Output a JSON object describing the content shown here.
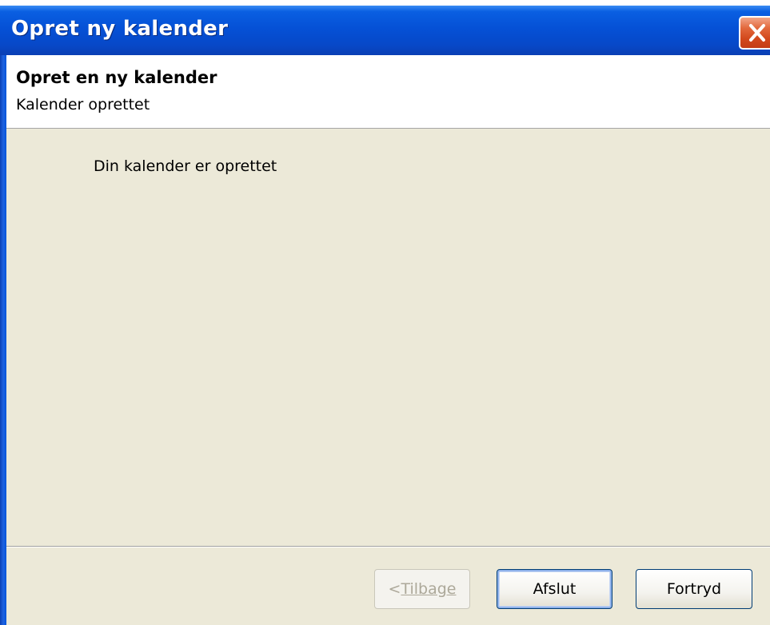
{
  "window": {
    "title": "Opret ny kalender"
  },
  "header": {
    "title": "Opret en ny kalender",
    "subtitle": "Kalender oprettet"
  },
  "main": {
    "message": "Din kalender er oprettet"
  },
  "buttons": {
    "back_prefix": "< ",
    "back_label": "Tilbage",
    "back_enabled": false,
    "finish_label": "Afslut",
    "cancel_label": "Fortryd"
  },
  "colors": {
    "titlebar": "#0551d6",
    "close": "#d2481c",
    "panel": "#ece9d8"
  },
  "icons": {
    "close": "close-icon"
  }
}
